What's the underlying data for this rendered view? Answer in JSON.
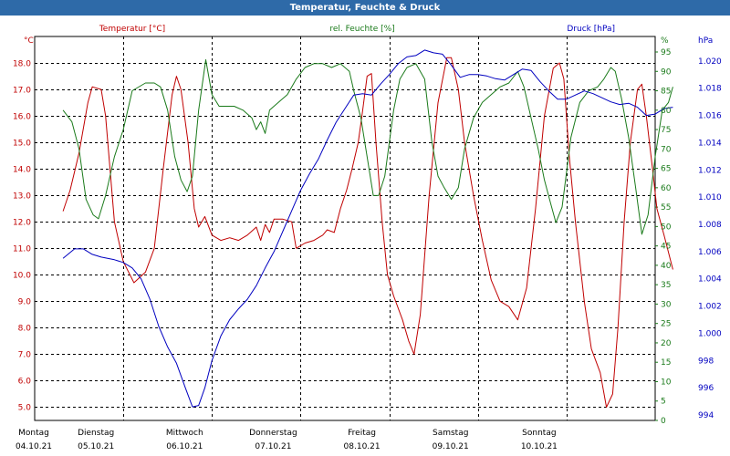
{
  "title": "Temperatur, Feuchte & Druck",
  "colors": {
    "titlebar": "#2e6aa8",
    "temperature": "#c00000",
    "humidity": "#1a7a1a",
    "pressure": "#0000c0",
    "grid": "#000000"
  },
  "chart_data": {
    "type": "line",
    "title": "Temperatur, Feuchte & Druck",
    "grid": true,
    "x_labels": [
      {
        "day": "Montag",
        "date": "04.10.21"
      },
      {
        "day": "Dienstag",
        "date": "05.10.21"
      },
      {
        "day": "Mittwoch",
        "date": "06.10.21"
      },
      {
        "day": "Donnerstag",
        "date": "07.10.21"
      },
      {
        "day": "Freitag",
        "date": "08.10.21"
      },
      {
        "day": "Samstag",
        "date": "09.10.21"
      },
      {
        "day": "Sonntag",
        "date": "10.10.21"
      }
    ],
    "x_unit": "days since Montag 04.10.21 00:00",
    "xlim": [
      0,
      7
    ],
    "axes": {
      "temperature": {
        "unit": "°C",
        "ylim": [
          4.5,
          19.0
        ],
        "ticks": [
          "5.0",
          "6.0",
          "7.0",
          "8.0",
          "9.0",
          "10.0",
          "11.0",
          "12.0",
          "13.0",
          "14.0",
          "15.0",
          "16.0",
          "17.0",
          "18.0"
        ]
      },
      "humidity": {
        "unit": "%",
        "ylim": [
          0,
          99
        ],
        "ticks": [
          "0",
          "5",
          "10",
          "15",
          "20",
          "25",
          "30",
          "35",
          "40",
          "45",
          "50",
          "55",
          "60",
          "65",
          "70",
          "75",
          "80",
          "85",
          "90",
          "95",
          "%"
        ]
      },
      "pressure": {
        "unit": "hPa",
        "ylim": [
          993.6,
          1021.8
        ],
        "ticks": [
          "994",
          "996",
          "998",
          "1.000",
          "1.002",
          "1.004",
          "1.006",
          "1.008",
          "1.010",
          "1.012",
          "1.014",
          "1.016",
          "1.018",
          "1.020"
        ]
      }
    },
    "series": [
      {
        "name": "Temperatur [°C]",
        "axis": "temperature",
        "points": [
          [
            0.32,
            12.4
          ],
          [
            0.4,
            13.2
          ],
          [
            0.5,
            14.6
          ],
          [
            0.6,
            16.5
          ],
          [
            0.65,
            17.1
          ],
          [
            0.75,
            17.0
          ],
          [
            0.8,
            16.0
          ],
          [
            0.9,
            12.0
          ],
          [
            1.0,
            10.5
          ],
          [
            1.12,
            9.7
          ],
          [
            1.25,
            10.1
          ],
          [
            1.35,
            11.0
          ],
          [
            1.45,
            14.0
          ],
          [
            1.55,
            16.8
          ],
          [
            1.6,
            17.5
          ],
          [
            1.65,
            17.0
          ],
          [
            1.73,
            15.0
          ],
          [
            1.8,
            12.5
          ],
          [
            1.85,
            11.8
          ],
          [
            1.92,
            12.2
          ],
          [
            2.0,
            11.5
          ],
          [
            2.1,
            11.3
          ],
          [
            2.2,
            11.4
          ],
          [
            2.3,
            11.3
          ],
          [
            2.4,
            11.5
          ],
          [
            2.5,
            11.8
          ],
          [
            2.55,
            11.3
          ],
          [
            2.6,
            11.9
          ],
          [
            2.65,
            11.6
          ],
          [
            2.7,
            12.1
          ],
          [
            2.8,
            12.1
          ],
          [
            2.9,
            12.0
          ],
          [
            2.95,
            11.0
          ],
          [
            3.05,
            11.2
          ],
          [
            3.15,
            11.3
          ],
          [
            3.25,
            11.5
          ],
          [
            3.3,
            11.7
          ],
          [
            3.38,
            11.6
          ],
          [
            3.45,
            12.5
          ],
          [
            3.52,
            13.2
          ],
          [
            3.58,
            14.0
          ],
          [
            3.65,
            15.0
          ],
          [
            3.7,
            16.2
          ],
          [
            3.75,
            17.5
          ],
          [
            3.8,
            17.6
          ],
          [
            3.85,
            15.0
          ],
          [
            3.92,
            12.0
          ],
          [
            3.98,
            10.0
          ],
          [
            4.05,
            9.2
          ],
          [
            4.15,
            8.3
          ],
          [
            4.22,
            7.5
          ],
          [
            4.28,
            7.0
          ],
          [
            4.35,
            8.5
          ],
          [
            4.45,
            13.0
          ],
          [
            4.55,
            16.5
          ],
          [
            4.65,
            18.2
          ],
          [
            4.7,
            18.2
          ],
          [
            4.78,
            17.0
          ],
          [
            4.85,
            15.0
          ],
          [
            4.95,
            13.0
          ],
          [
            5.05,
            11.3
          ],
          [
            5.15,
            9.8
          ],
          [
            5.25,
            9.0
          ],
          [
            5.35,
            8.8
          ],
          [
            5.45,
            8.3
          ],
          [
            5.55,
            9.5
          ],
          [
            5.65,
            12.5
          ],
          [
            5.75,
            16.0
          ],
          [
            5.85,
            17.8
          ],
          [
            5.92,
            18.0
          ],
          [
            5.97,
            17.4
          ],
          [
            6.03,
            14.5
          ],
          [
            6.1,
            12.0
          ],
          [
            6.2,
            9.0
          ],
          [
            6.28,
            7.2
          ],
          [
            6.38,
            6.3
          ],
          [
            6.45,
            5.0
          ],
          [
            6.52,
            5.5
          ],
          [
            6.58,
            8.0
          ],
          [
            6.65,
            12.0
          ],
          [
            6.72,
            15.0
          ],
          [
            6.8,
            17.0
          ],
          [
            6.85,
            17.2
          ],
          [
            6.9,
            16.0
          ],
          [
            6.97,
            14.0
          ],
          [
            7.02,
            12.5
          ],
          [
            7.1,
            11.5
          ],
          [
            7.2,
            10.2
          ]
        ]
      },
      {
        "name": "rel. Feuchte [%]",
        "axis": "humidity",
        "points": [
          [
            0.32,
            80
          ],
          [
            0.42,
            77
          ],
          [
            0.5,
            70
          ],
          [
            0.58,
            57
          ],
          [
            0.66,
            53
          ],
          [
            0.72,
            52
          ],
          [
            0.8,
            58
          ],
          [
            0.9,
            68
          ],
          [
            1.0,
            75
          ],
          [
            1.1,
            85
          ],
          [
            1.25,
            87
          ],
          [
            1.35,
            87
          ],
          [
            1.42,
            86
          ],
          [
            1.5,
            80
          ],
          [
            1.58,
            68
          ],
          [
            1.65,
            62
          ],
          [
            1.72,
            59
          ],
          [
            1.78,
            63
          ],
          [
            1.85,
            80
          ],
          [
            1.93,
            93
          ],
          [
            2.0,
            84
          ],
          [
            2.08,
            81
          ],
          [
            2.15,
            81
          ],
          [
            2.25,
            81
          ],
          [
            2.35,
            80
          ],
          [
            2.45,
            78
          ],
          [
            2.5,
            75
          ],
          [
            2.55,
            77
          ],
          [
            2.6,
            74
          ],
          [
            2.65,
            80
          ],
          [
            2.75,
            82
          ],
          [
            2.85,
            84
          ],
          [
            2.95,
            88
          ],
          [
            3.05,
            91
          ],
          [
            3.15,
            92
          ],
          [
            3.25,
            92
          ],
          [
            3.35,
            91
          ],
          [
            3.45,
            92
          ],
          [
            3.55,
            90
          ],
          [
            3.6,
            85
          ],
          [
            3.68,
            78
          ],
          [
            3.75,
            68
          ],
          [
            3.82,
            58
          ],
          [
            3.88,
            58
          ],
          [
            3.95,
            63
          ],
          [
            4.05,
            80
          ],
          [
            4.12,
            88
          ],
          [
            4.2,
            91
          ],
          [
            4.3,
            92
          ],
          [
            4.4,
            88
          ],
          [
            4.48,
            72
          ],
          [
            4.55,
            63
          ],
          [
            4.62,
            60
          ],
          [
            4.7,
            57
          ],
          [
            4.78,
            60
          ],
          [
            4.85,
            70
          ],
          [
            4.95,
            78
          ],
          [
            5.05,
            82
          ],
          [
            5.15,
            84
          ],
          [
            5.25,
            86
          ],
          [
            5.35,
            87
          ],
          [
            5.45,
            90
          ],
          [
            5.52,
            86
          ],
          [
            5.6,
            78
          ],
          [
            5.68,
            70
          ],
          [
            5.75,
            62
          ],
          [
            5.82,
            56
          ],
          [
            5.88,
            51
          ],
          [
            5.95,
            55
          ],
          [
            6.05,
            73
          ],
          [
            6.15,
            82
          ],
          [
            6.25,
            85
          ],
          [
            6.35,
            86
          ],
          [
            6.42,
            88
          ],
          [
            6.5,
            91
          ],
          [
            6.55,
            90
          ],
          [
            6.62,
            83
          ],
          [
            6.7,
            73
          ],
          [
            6.78,
            60
          ],
          [
            6.85,
            48
          ],
          [
            6.92,
            53
          ],
          [
            7.0,
            68
          ],
          [
            7.08,
            80
          ],
          [
            7.15,
            82
          ],
          [
            7.2,
            86
          ]
        ]
      },
      {
        "name": "Druck [hPa]",
        "axis": "pressure",
        "points": [
          [
            0.32,
            1005.5
          ],
          [
            0.45,
            1006.2
          ],
          [
            0.55,
            1006.2
          ],
          [
            0.65,
            1005.8
          ],
          [
            0.75,
            1005.6
          ],
          [
            0.9,
            1005.4
          ],
          [
            1.0,
            1005.2
          ],
          [
            1.1,
            1004.8
          ],
          [
            1.2,
            1004.0
          ],
          [
            1.3,
            1002.5
          ],
          [
            1.4,
            1000.5
          ],
          [
            1.5,
            999.0
          ],
          [
            1.6,
            997.8
          ],
          [
            1.7,
            996.0
          ],
          [
            1.78,
            994.6
          ],
          [
            1.85,
            994.7
          ],
          [
            1.92,
            996.0
          ],
          [
            2.0,
            998.0
          ],
          [
            2.1,
            999.8
          ],
          [
            2.2,
            1001.0
          ],
          [
            2.3,
            1001.8
          ],
          [
            2.4,
            1002.5
          ],
          [
            2.5,
            1003.5
          ],
          [
            2.6,
            1004.8
          ],
          [
            2.7,
            1006.0
          ],
          [
            2.8,
            1007.5
          ],
          [
            2.9,
            1009.0
          ],
          [
            3.0,
            1010.5
          ],
          [
            3.1,
            1011.7
          ],
          [
            3.2,
            1012.8
          ],
          [
            3.3,
            1014.2
          ],
          [
            3.4,
            1015.5
          ],
          [
            3.5,
            1016.5
          ],
          [
            3.6,
            1017.5
          ],
          [
            3.7,
            1017.6
          ],
          [
            3.8,
            1017.5
          ],
          [
            3.9,
            1018.3
          ],
          [
            4.0,
            1019.0
          ],
          [
            4.1,
            1019.8
          ],
          [
            4.2,
            1020.3
          ],
          [
            4.3,
            1020.4
          ],
          [
            4.4,
            1020.8
          ],
          [
            4.5,
            1020.6
          ],
          [
            4.6,
            1020.5
          ],
          [
            4.7,
            1019.7
          ],
          [
            4.8,
            1018.8
          ],
          [
            4.9,
            1019.0
          ],
          [
            5.0,
            1019.0
          ],
          [
            5.1,
            1018.9
          ],
          [
            5.2,
            1018.7
          ],
          [
            5.3,
            1018.6
          ],
          [
            5.4,
            1019.0
          ],
          [
            5.5,
            1019.4
          ],
          [
            5.6,
            1019.3
          ],
          [
            5.7,
            1018.5
          ],
          [
            5.8,
            1017.8
          ],
          [
            5.9,
            1017.2
          ],
          [
            6.0,
            1017.2
          ],
          [
            6.1,
            1017.5
          ],
          [
            6.2,
            1017.8
          ],
          [
            6.3,
            1017.6
          ],
          [
            6.4,
            1017.3
          ],
          [
            6.5,
            1017.0
          ],
          [
            6.6,
            1016.8
          ],
          [
            6.7,
            1016.9
          ],
          [
            6.8,
            1016.6
          ],
          [
            6.9,
            1016.0
          ],
          [
            7.0,
            1016.1
          ],
          [
            7.1,
            1016.5
          ],
          [
            7.2,
            1016.6
          ]
        ]
      }
    ]
  }
}
